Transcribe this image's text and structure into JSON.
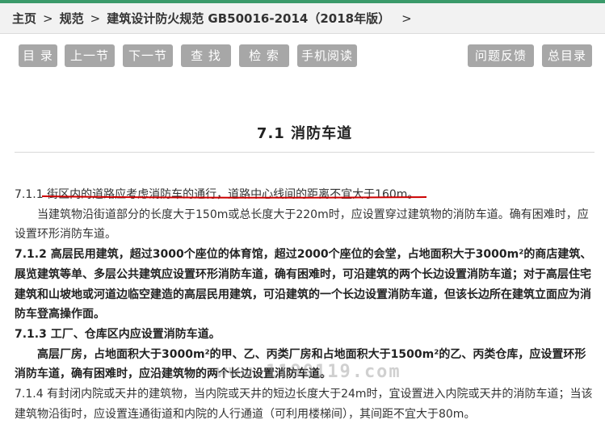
{
  "breadcrumb": {
    "home": "主页",
    "sep": ">",
    "section": "规范",
    "current": "建筑设计防火规范 GB50016-2014（2018年版）"
  },
  "toolbar": {
    "contents": "目 录",
    "prev": "上一节",
    "next": "下一节",
    "find": "查 找",
    "search": "检 索",
    "mobile": "手机阅读",
    "feedback": "问题反馈",
    "index": "总目录"
  },
  "section_title": "7.1 消防车道",
  "paragraphs": [
    {
      "text": "7.1.1 街区内的道路应考虑消防车的通行，道路中心线间的距离不宜大于160m。",
      "style": "normal"
    },
    {
      "text": "当建筑物沿街道部分的长度大于150m或总长度大于220m时，应设置穿过建筑物的消防车道。确有困难时，应设置环形消防车道。",
      "style": "indent"
    },
    {
      "text": "7.1.2 高层民用建筑，超过3000个座位的体育馆，超过2000个座位的会堂，占地面积大于3000m²的商店建筑、展览建筑等单、多层公共建筑应设置环形消防车道，确有困难时，可沿建筑的两个长边设置消防车道；对于高层住宅建筑和山坡地或河道边临空建造的高层民用建筑，可沿建筑的一个长边设置消防车道，但该长边所在建筑立面应为消防车登高操作面。",
      "style": "bold"
    },
    {
      "text": "7.1.3 工厂、仓库区内应设置消防车道。",
      "style": "bold"
    },
    {
      "text": "高层厂房，占地面积大于3000m²的甲、乙、丙类厂房和占地面积大于1500m²的乙、丙类仓库，应设置环形消防车道，确有困难时，应沿建筑物的两个长边设置消防车道。",
      "style": "bold-indent"
    },
    {
      "text": "7.1.4 有封闭内院或天井的建筑物，当内院或天井的短边长度大于24m时，宜设置进入内院或天井的消防车道；当该建筑物沿街时，应设置连通街道和内院的人行通道（可利用楼梯间），其间距不宜大于80m。",
      "style": "normal"
    }
  ],
  "watermark": "www.1190119.com",
  "colors": {
    "button_bg": "#a7a7a7",
    "header_bg": "#f2f2f2",
    "annotation": "#cc0000",
    "accent_top": "#3a9a6a"
  }
}
